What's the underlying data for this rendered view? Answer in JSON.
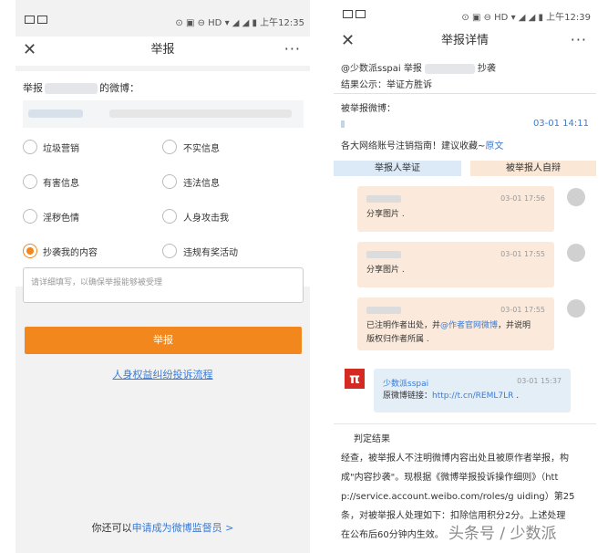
{
  "left": {
    "status": {
      "left": "▪ ▪",
      "right": "⊙ ▣ ⊖ HD ▾ ◢ ◢ ▮ 上午12:35"
    },
    "nav": {
      "title": "举报",
      "more": "···"
    },
    "prompt": {
      "prefix": "举报",
      "suffix": "的微博："
    },
    "options": [
      {
        "label": "垃圾营销",
        "selected": false
      },
      {
        "label": "不实信息",
        "selected": false
      },
      {
        "label": "有害信息",
        "selected": false
      },
      {
        "label": "违法信息",
        "selected": false
      },
      {
        "label": "淫秽色情",
        "selected": false
      },
      {
        "label": "人身攻击我",
        "selected": false
      },
      {
        "label": "抄袭我的内容",
        "selected": true
      },
      {
        "label": "违规有奖活动",
        "selected": false
      }
    ],
    "textarea_placeholder": "请详细填写，以确保举报能够被受理",
    "submit_label": "举报",
    "process_link": "人身权益纠纷投诉流程",
    "footer_prefix": "你还可以",
    "footer_link": "申请成为微博监督员 >"
  },
  "right": {
    "status": {
      "left": "▪ ▪",
      "right": "⊙ ▣ ⊖ HD ▾ ◢ ◢ ▮ 上午12:39"
    },
    "nav": {
      "title": "举报详情",
      "more": "···"
    },
    "header_line1_prefix": "@少数派sspai 举报",
    "header_line1_suffix": "抄袭",
    "header_line2": "结果公示：举证方胜诉",
    "reported_label": "被举报微博：",
    "reported_time": "03-01 14:11",
    "reported_text": "各大网络账号注销指南！建议收藏~",
    "reported_link": "原文",
    "tab_reporter": "举报人举证",
    "tab_reported": "被举报人自辩",
    "messages": [
      {
        "time": "03-01 17:56",
        "text": "分享图片 ."
      },
      {
        "time": "03-01 17:55",
        "text": "分享图片 ."
      },
      {
        "time": "03-01 17:55",
        "text_pre": "已注明作者出处，并",
        "text_link": "@作者官网微博",
        "text_post": "，并说明",
        "text_line2": "版权归作者所属 ."
      }
    ],
    "reporter_msg": {
      "name": "少数派sspai",
      "time": "03-01 15:37",
      "text_pre": "原微博链接：",
      "text_link": "http://t.cn/REML7LR",
      "text_post": " ."
    },
    "logo_char": "π",
    "verdict_title": "判定结果",
    "verdict_lines": [
      "经查，被举报人不注明微博内容出处且被原作者举报，构",
      "成\"内容抄袭\"。现根据《微博举报投诉操作细则》（htt",
      "p://service.account.weibo.com/roles/g uiding）第25",
      "条，对被举报人处理如下：扣除信用积分2分。上述处理",
      "在公布后60分钟内生效。"
    ],
    "watermark": "头条号 / 少数派"
  },
  "colors": {
    "accent": "#f2871d",
    "link": "#3a7bd5",
    "tab_blue": "#dce9f6",
    "tab_orange": "#fbe7d6"
  }
}
